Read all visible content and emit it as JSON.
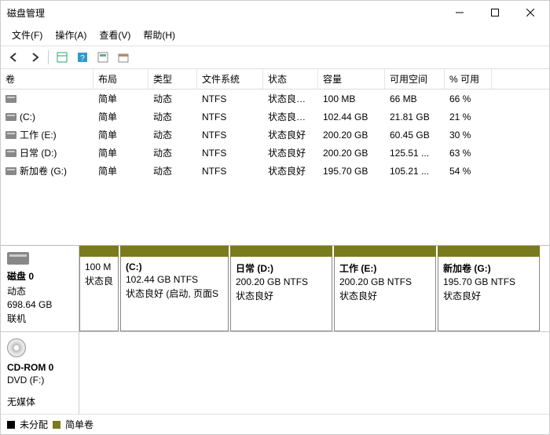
{
  "window": {
    "title": "磁盘管理"
  },
  "menu": {
    "file": "文件(F)",
    "action": "操作(A)",
    "view": "查看(V)",
    "help": "帮助(H)"
  },
  "columns": {
    "volume": "卷",
    "layout": "布局",
    "type": "类型",
    "fs": "文件系统",
    "status": "状态",
    "capacity": "容量",
    "free": "可用空间",
    "pct": "% 可用"
  },
  "rows": [
    {
      "vol": "",
      "layout": "简单",
      "type": "动态",
      "fs": "NTFS",
      "status": "状态良好 (...",
      "cap": "100 MB",
      "free": "66 MB",
      "pct": "66 %"
    },
    {
      "vol": "(C:)",
      "layout": "简单",
      "type": "动态",
      "fs": "NTFS",
      "status": "状态良好 (...",
      "cap": "102.44 GB",
      "free": "21.81 GB",
      "pct": "21 %"
    },
    {
      "vol": "工作 (E:)",
      "layout": "简单",
      "type": "动态",
      "fs": "NTFS",
      "status": "状态良好",
      "cap": "200.20 GB",
      "free": "60.45 GB",
      "pct": "30 %"
    },
    {
      "vol": "日常 (D:)",
      "layout": "简单",
      "type": "动态",
      "fs": "NTFS",
      "status": "状态良好",
      "cap": "200.20 GB",
      "free": "125.51 ...",
      "pct": "63 %"
    },
    {
      "vol": "新加卷 (G:)",
      "layout": "简单",
      "type": "动态",
      "fs": "NTFS",
      "status": "状态良好",
      "cap": "195.70 GB",
      "free": "105.21 ...",
      "pct": "54 %"
    }
  ],
  "disk0": {
    "name": "磁盘 0",
    "type": "动态",
    "size": "698.64 GB",
    "status": "联机",
    "parts": [
      {
        "title": "",
        "line1": "100 M",
        "line2": "状态良",
        "w": 50
      },
      {
        "title": "(C:)",
        "line1": "102.44 GB NTFS",
        "line2": "状态良好 (启动, 页面S",
        "w": 138
      },
      {
        "title": "日常   (D:)",
        "line1": "200.20 GB NTFS",
        "line2": "状态良好",
        "w": 130
      },
      {
        "title": "工作   (E:)",
        "line1": "200.20 GB NTFS",
        "line2": "状态良好",
        "w": 130
      },
      {
        "title": "新加卷   (G:)",
        "line1": "195.70 GB NTFS",
        "line2": "状态良好",
        "w": 130
      }
    ]
  },
  "cdrom": {
    "name": "CD-ROM 0",
    "drive": "DVD (F:)",
    "status": "无媒体"
  },
  "legend": {
    "unalloc": "未分配",
    "simple": "简单卷"
  }
}
